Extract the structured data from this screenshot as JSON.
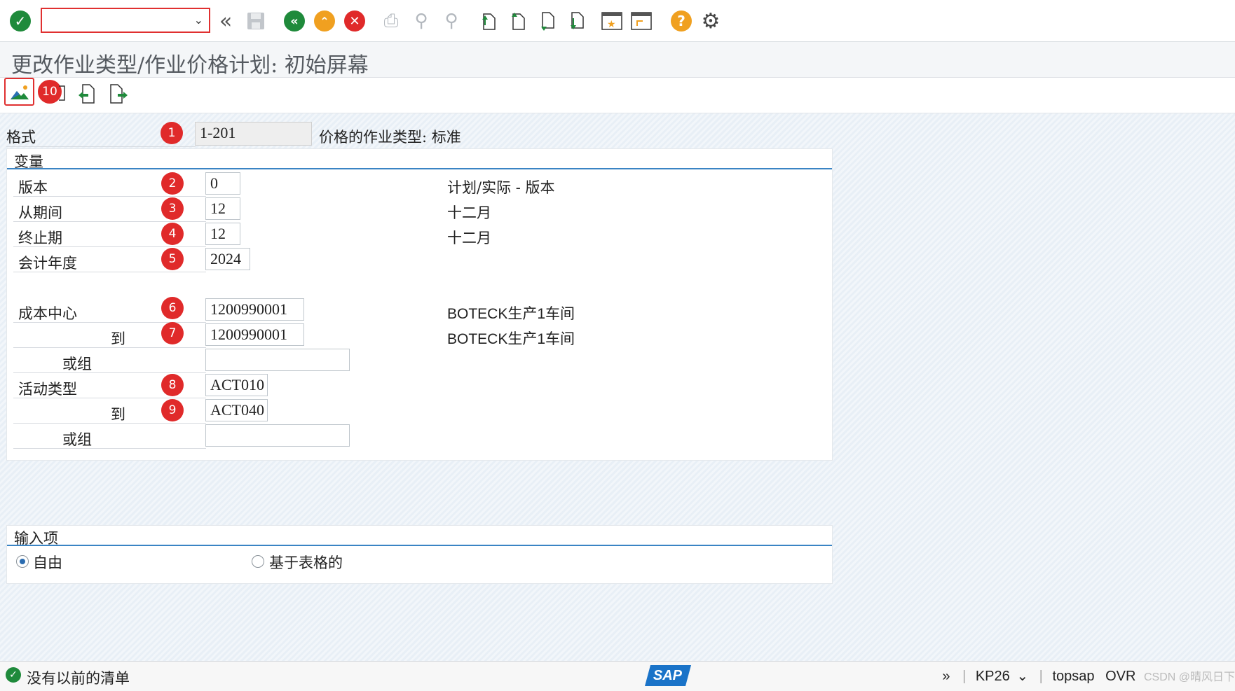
{
  "toolbar": {
    "command_field_value": "",
    "icons": [
      "enter-icon",
      "command-dropdown-icon",
      "collapse-icon",
      "save-icon",
      "back-icon",
      "exit-icon",
      "cancel-icon",
      "print-icon",
      "find-icon",
      "find-next-icon",
      "first-page-icon",
      "previous-page-icon",
      "next-page-icon",
      "last-page-icon",
      "new-session-icon",
      "shortcut-icon",
      "help-icon",
      "settings-icon"
    ],
    "colors": {
      "green": "#1f8a3b",
      "orange": "#f0a020",
      "red": "#e02a2a"
    }
  },
  "title": "更改作业类型/作业价格计划: 初始屏幕",
  "app_toolbar": {
    "badge": "10",
    "icons": [
      "overview-icon",
      "display-icon",
      "import-icon",
      "export-icon"
    ]
  },
  "form": {
    "layout_label": "格式",
    "layout_value": "1-201",
    "layout_desc": "价格的作业类型: 标准",
    "variables_title": "变量",
    "version_label": "版本",
    "version_value": "0",
    "version_desc": "计划/实际 - 版本",
    "from_period_label": "从期间",
    "from_period_value": "12",
    "from_period_desc": "十二月",
    "to_period_label": "终止期",
    "to_period_value": "12",
    "to_period_desc": "十二月",
    "fiscal_year_label": "会计年度",
    "fiscal_year_value": "2024",
    "cost_center_label": "成本中心",
    "cost_center_value": "1200990001",
    "cost_center_desc": "BOTECK生产1车间",
    "cost_center_to_label": "到",
    "cost_center_to_value": "1200990001",
    "cost_center_to_desc": "BOTECK生产1车间",
    "cost_center_group_label": "或组",
    "cost_center_group_value": "",
    "activity_type_label": "活动类型",
    "activity_type_value": "ACT010",
    "activity_type_to_label": "到",
    "activity_type_to_value": "ACT040",
    "activity_group_label": "或组",
    "activity_group_value": "",
    "badges": [
      "1",
      "2",
      "3",
      "4",
      "5",
      "6",
      "7",
      "8",
      "9"
    ]
  },
  "entry": {
    "title": "输入项",
    "option_free": "自由",
    "option_form": "基于表格的",
    "selected": "自由"
  },
  "status": {
    "message": "没有以前的清单",
    "transaction": "KP26",
    "user": "topsap",
    "mode": "OVR",
    "logo": "SAP",
    "watermark": "CSDN @晴风日下"
  }
}
